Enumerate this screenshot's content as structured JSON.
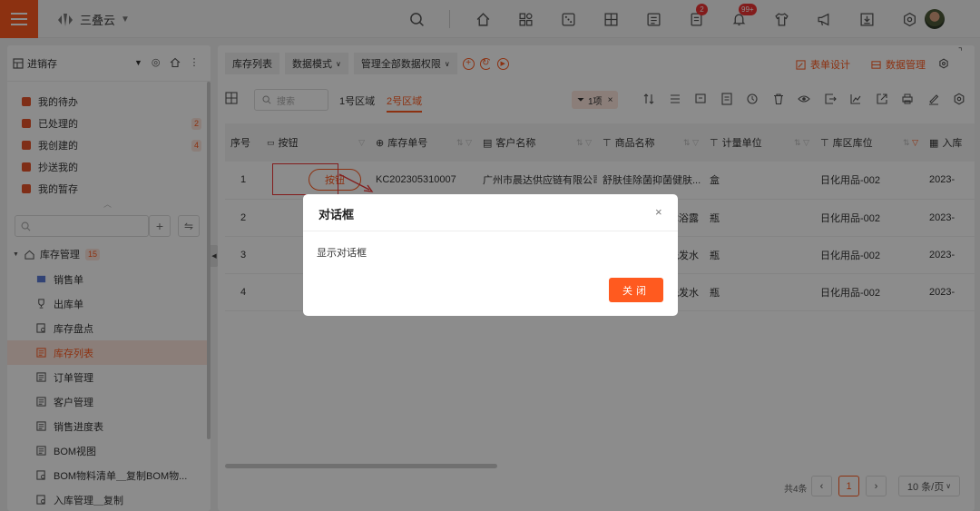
{
  "app": {
    "name": "三叠云"
  },
  "colors": {
    "accent": "#ff5a1f",
    "badge": "#e33333",
    "active_bg": "#fde6dd"
  },
  "header": {
    "icons": [
      "search-icon",
      "home-icon",
      "apps-icon",
      "dice-icon",
      "window-icon",
      "list-icon",
      "approval-icon",
      "bell-icon",
      "shirt-icon",
      "megaphone-icon",
      "download-icon",
      "gear-icon"
    ],
    "approval_badge": "2",
    "bell_badge": "99+"
  },
  "sidebar": {
    "title": "进销存",
    "tasks": [
      {
        "label": "我的待办",
        "count": ""
      },
      {
        "label": "已处理的",
        "count": "2"
      },
      {
        "label": "我创建的",
        "count": "4"
      },
      {
        "label": "抄送我的",
        "count": ""
      },
      {
        "label": "我的暂存",
        "count": ""
      }
    ],
    "search_placeholder": "",
    "tree": {
      "root_label": "库存管理",
      "root_count": "15",
      "items": [
        {
          "label": "销售单",
          "active": false
        },
        {
          "label": "出库单",
          "active": false
        },
        {
          "label": "库存盘点",
          "active": false
        },
        {
          "label": "库存列表",
          "active": true
        },
        {
          "label": "订单管理",
          "active": false
        },
        {
          "label": "客户管理",
          "active": false
        },
        {
          "label": "销售进度表",
          "active": false
        },
        {
          "label": "BOM视图",
          "active": false
        },
        {
          "label": "BOM物料清单＿复制BOM物...",
          "active": false
        },
        {
          "label": "入库管理＿复制",
          "active": false
        }
      ]
    }
  },
  "breadcrumb": {
    "items": [
      "库存列表",
      "数据模式",
      "管理全部数据权限"
    ]
  },
  "header_actions": {
    "form_design": "表单设计",
    "data_manage": "数据管理"
  },
  "toolbar": {
    "search_placeholder": "搜索",
    "area1": "1号区域",
    "area2": "2号区域",
    "filter_chip": "1项"
  },
  "table": {
    "columns": [
      "序号",
      "按钮",
      "库存单号",
      "客户名称",
      "商品名称",
      "计量单位",
      "库区库位",
      "入库"
    ],
    "button_label": "按钮",
    "rows": [
      {
        "no": "1",
        "order": "KC202305310007",
        "customer": "广州市晨达供应链有限公司",
        "product": "舒肤佳除菌抑菌健肤...",
        "unit": "盒",
        "location": "日化用品-002",
        "date": "2023-"
      },
      {
        "no": "2",
        "order": "",
        "customer": "",
        "product": "沐浴露",
        "unit": "瓶",
        "location": "日化用品-002",
        "date": "2023-"
      },
      {
        "no": "3",
        "order": "",
        "customer": "",
        "product": "洗发水",
        "unit": "瓶",
        "location": "日化用品-002",
        "date": "2023-"
      },
      {
        "no": "4",
        "order": "",
        "customer": "",
        "product": "洗发水",
        "unit": "瓶",
        "location": "日化用品-002",
        "date": "2023-"
      }
    ]
  },
  "pagination": {
    "total": "共4条",
    "page": "1",
    "page_size": "10 条/页"
  },
  "dialog": {
    "title": "对话框",
    "body": "显示对话框",
    "close_button": "关闭"
  }
}
